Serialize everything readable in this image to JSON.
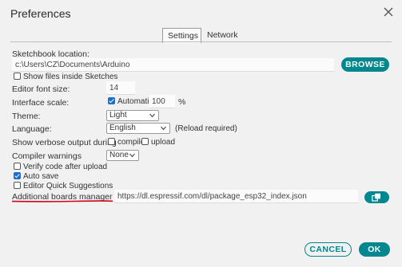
{
  "window": {
    "title": "Preferences"
  },
  "tabs": [
    {
      "label": "Settings",
      "active": true
    },
    {
      "label": "Network",
      "active": false
    }
  ],
  "sketchbook": {
    "label": "Sketchbook location:",
    "value": "c:\\Users\\CZ\\Documents\\Arduino",
    "browse_label": "BROWSE",
    "show_files_label": "Show files inside Sketches",
    "show_files_checked": false
  },
  "editor_font_size": {
    "label": "Editor font size:",
    "value": "14"
  },
  "interface_scale": {
    "label": "Interface scale:",
    "automatic_label": "Automatic",
    "automatic_checked": true,
    "value": "100",
    "unit": "%"
  },
  "theme": {
    "label": "Theme:",
    "selected": "Light"
  },
  "language": {
    "label": "Language:",
    "selected": "English",
    "note": "(Reload required)"
  },
  "verbose": {
    "label": "Show verbose output during",
    "compile_label": "compile",
    "compile_checked": false,
    "upload_label": "upload",
    "upload_checked": false
  },
  "compiler_warnings": {
    "label": "Compiler warnings",
    "selected": "None"
  },
  "options": {
    "verify_label": "Verify code after upload",
    "verify_checked": false,
    "autosave_label": "Auto save",
    "autosave_checked": true,
    "quick_suggestions_label": "Editor Quick Suggestions",
    "quick_suggestions_checked": false
  },
  "boards_manager": {
    "label": "Additional boards manager URLs:",
    "value": "https://dl.espressif.com/dl/package_esp32_index.json"
  },
  "footer": {
    "cancel_label": "CANCEL",
    "ok_label": "OK"
  },
  "colors": {
    "accent": "#00878f",
    "checkbox": "#1a6fd1",
    "annotation": "#d0021b"
  },
  "icons": {
    "close": "close-icon",
    "edit_urls": "open-window-icon",
    "dropdown": "chevron-down-icon"
  }
}
